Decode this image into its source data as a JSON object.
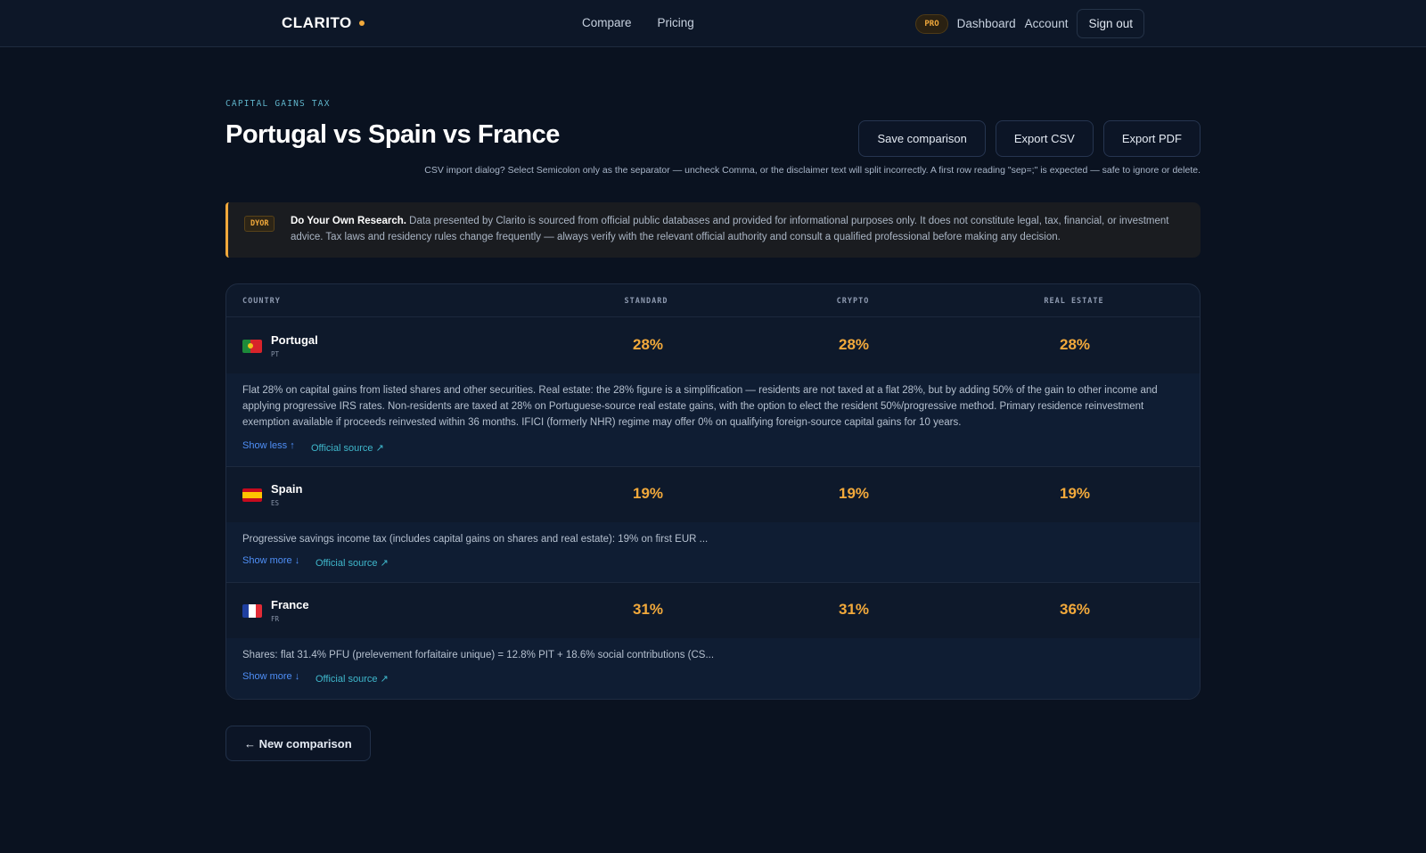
{
  "nav": {
    "logo": "CLARITO",
    "links": [
      "Compare",
      "Pricing"
    ],
    "pro_badge": "PRO",
    "dashboard": "Dashboard",
    "account": "Account",
    "sign_out": "Sign out"
  },
  "header": {
    "eyebrow": "CAPITAL GAINS TAX",
    "title": "Portugal vs Spain vs France",
    "save_label": "Save comparison",
    "export_csv_label": "Export CSV",
    "export_pdf_label": "Export PDF",
    "csv_note": "CSV import dialog? Select Semicolon only as the separator — uncheck Comma, or the disclaimer text will split incorrectly. A first row reading \"sep=;\" is expected — safe to ignore or delete."
  },
  "disclaimer": {
    "badge": "DYOR",
    "title": "Do Your Own Research.",
    "text": "Data presented by Clarito is sourced from official public databases and provided for informational purposes only. It does not constitute legal, tax, financial, or investment advice. Tax laws and residency rules change frequently — always verify with the relevant official authority and consult a qualified professional before making any decision."
  },
  "table": {
    "columns": [
      "COUNTRY",
      "STANDARD",
      "CRYPTO",
      "REAL ESTATE"
    ],
    "rows": [
      {
        "name": "Portugal",
        "code": "PT",
        "standard": "28%",
        "crypto": "28%",
        "real_estate": "28%",
        "detail": "Flat 28% on capital gains from listed shares and other securities. Real estate: the 28% figure is a simplification — residents are not taxed at a flat 28%, but by adding 50% of the gain to other income and applying progressive IRS rates. Non-residents are taxed at 28% on Portuguese-source real estate gains, with the option to elect the resident 50%/progressive method. Primary residence reinvestment exemption available if proceeds reinvested within 36 months. IFICI (formerly NHR) regime may offer 0% on qualifying foreign-source capital gains for 10 years.",
        "toggle": "Show less ↑",
        "source": "Official source ↗"
      },
      {
        "name": "Spain",
        "code": "ES",
        "standard": "19%",
        "crypto": "19%",
        "real_estate": "19%",
        "detail": "Progressive savings income tax (includes capital gains on shares and real estate): 19% on first EUR ...",
        "toggle": "Show more ↓",
        "source": "Official source ↗"
      },
      {
        "name": "France",
        "code": "FR",
        "standard": "31%",
        "crypto": "31%",
        "real_estate": "36%",
        "detail": "Shares: flat 31.4% PFU (prelevement forfaitaire unique) = 12.8% PIT + 18.6% social contributions (CS...",
        "toggle": "Show more ↓",
        "source": "Official source ↗"
      }
    ]
  },
  "footer": {
    "new_comparison": "← New comparison"
  },
  "colors": {
    "accent": "#f2a93b",
    "link": "#4f8ff7",
    "source_link": "#3fb8cc",
    "background": "#0a1220"
  }
}
